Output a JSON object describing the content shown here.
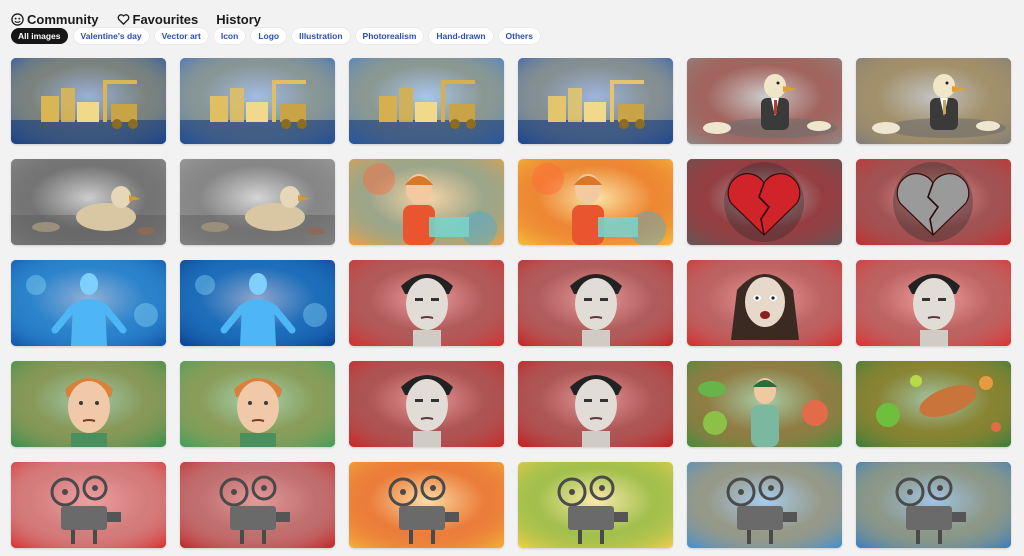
{
  "nav": {
    "community": "Community",
    "favourites": "Favourites",
    "history": "History"
  },
  "filters": [
    "All images",
    "Valentine's day",
    "Vector art",
    "Icon",
    "Logo",
    "Illustration",
    "Photorealism",
    "Hand-drawn",
    "Others"
  ],
  "active_filter": "All images",
  "colors": {
    "active_chip_bg": "#161616",
    "chip_text": "#2a4fb8",
    "page_bg": "#f2f2f3"
  },
  "gallery": {
    "tiles": [
      {
        "subject": "toy-blocks",
        "palette": [
          "#1d4fa8",
          "#d9b655"
        ]
      },
      {
        "subject": "toy-blocks",
        "palette": [
          "#2f6cc7",
          "#e0bf63"
        ]
      },
      {
        "subject": "toy-blocks",
        "palette": [
          "#3e7fd6",
          "#d6b04e"
        ]
      },
      {
        "subject": "toy-blocks",
        "palette": [
          "#2759b5",
          "#e2c56d"
        ]
      },
      {
        "subject": "duck-in-suit",
        "palette": [
          "#8d8d8d",
          "#b63b2e"
        ]
      },
      {
        "subject": "duck-in-suit",
        "palette": [
          "#7b7b7b",
          "#c9a45a"
        ]
      },
      {
        "subject": "ducks-in-water",
        "palette": [
          "#8f8f8f",
          "#5a5a5a"
        ]
      },
      {
        "subject": "ducks-in-water",
        "palette": [
          "#a3a3a3",
          "#6a6a6a"
        ]
      },
      {
        "subject": "boy-with-laptop",
        "palette": [
          "#f2a23b",
          "#47a9d8"
        ]
      },
      {
        "subject": "boy-with-laptop",
        "palette": [
          "#f6c33c",
          "#e44b2a"
        ]
      },
      {
        "subject": "broken-heart",
        "palette": [
          "#5a5a5a",
          "#d0232a"
        ]
      },
      {
        "subject": "broken-heart",
        "palette": [
          "#c92b2b",
          "#7a7a7a"
        ]
      },
      {
        "subject": "blue-figure",
        "palette": [
          "#0f4fa6",
          "#46b8f0"
        ]
      },
      {
        "subject": "blue-figure",
        "palette": [
          "#0b3b8c",
          "#2ea0e8"
        ]
      },
      {
        "subject": "man-portrait",
        "palette": [
          "#d82a2a",
          "#8a8a8a"
        ]
      },
      {
        "subject": "man-portrait",
        "palette": [
          "#c92020",
          "#999999"
        ]
      },
      {
        "subject": "woman-portrait",
        "palette": [
          "#d92626",
          "#a0a0a0"
        ]
      },
      {
        "subject": "man-portrait",
        "palette": [
          "#e02c2c",
          "#9a9a9a"
        ]
      },
      {
        "subject": "man-portrait-green",
        "palette": [
          "#2e8f4e",
          "#e0a060"
        ]
      },
      {
        "subject": "man-portrait-green",
        "palette": [
          "#3aa05a",
          "#d99a5a"
        ]
      },
      {
        "subject": "man-portrait",
        "palette": [
          "#d22020",
          "#888888"
        ]
      },
      {
        "subject": "man-portrait",
        "palette": [
          "#c81818",
          "#939393"
        ]
      },
      {
        "subject": "germs-and-child",
        "palette": [
          "#3c8f3c",
          "#e26b4a"
        ]
      },
      {
        "subject": "germs",
        "palette": [
          "#2f7d3a",
          "#e08a2a"
        ]
      },
      {
        "subject": "film-projector",
        "palette": [
          "#d82a2a",
          "#cfcfcf"
        ]
      },
      {
        "subject": "film-projector",
        "palette": [
          "#c42020",
          "#bdbdbd"
        ]
      },
      {
        "subject": "film-projector",
        "palette": [
          "#f4b43a",
          "#e2453a"
        ]
      },
      {
        "subject": "film-projector",
        "palette": [
          "#f7d04a",
          "#4fb04f"
        ]
      },
      {
        "subject": "film-projector",
        "palette": [
          "#3b8fd6",
          "#f2a33b"
        ]
      },
      {
        "subject": "film-projector",
        "palette": [
          "#2f7cc4",
          "#e8b24a"
        ]
      }
    ]
  }
}
